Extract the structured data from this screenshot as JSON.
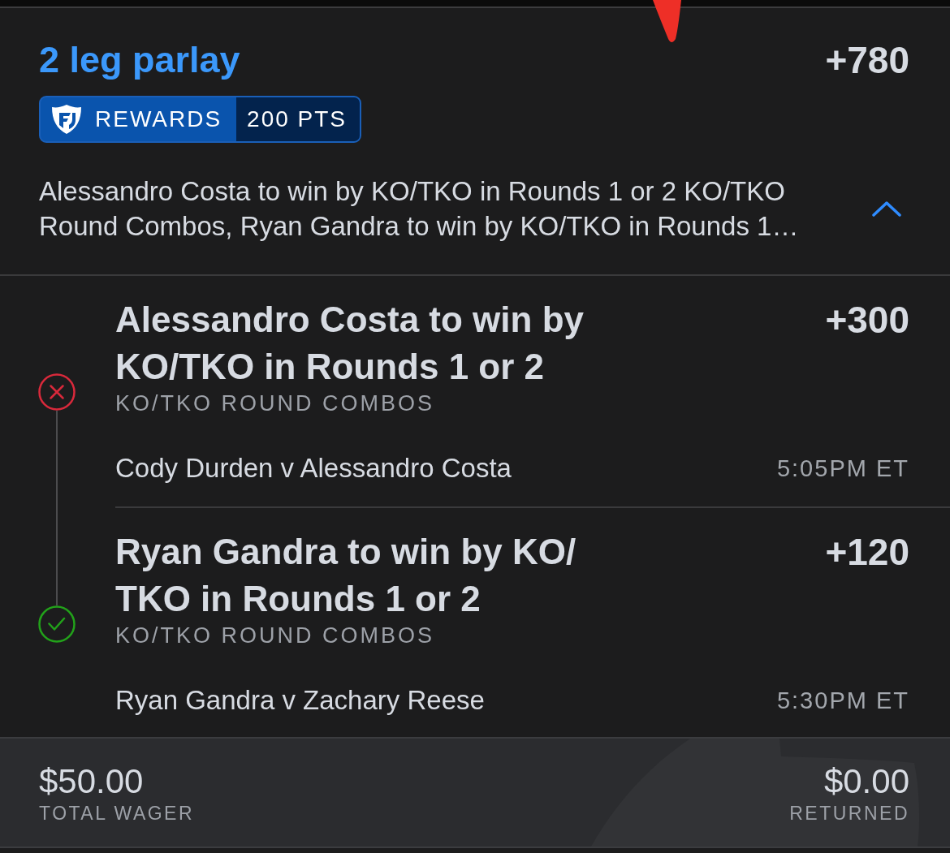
{
  "header": {
    "title": "2 leg parlay",
    "odds": "+780",
    "rewards": {
      "label": "REWARDS",
      "points": "200 PTS"
    },
    "summary": "Alessandro Costa to win by KO/TKO in Rounds 1 or 2 KO/TKO Round Combos, Ryan Gandra to win by KO/TKO in Rounds 1…",
    "expanded": true
  },
  "legs": [
    {
      "won": false,
      "selection": "Alessandro Costa to win by KO/TKO in Rounds 1 or 2",
      "odds": "+300",
      "market": "KO/TKO ROUND COMBOS",
      "event": "Cody Durden v Alessandro Costa",
      "time": "5:05PM ET"
    },
    {
      "won": true,
      "selection": "Ryan Gandra to win by KO/TKO in Rounds 1 or 2",
      "odds": "+120",
      "market": "KO/TKO ROUND COMBOS",
      "event": "Ryan Gandra v Zachary Reese",
      "time": "5:30PM ET"
    }
  ],
  "totals": [
    {
      "amount": "$50.00",
      "label": "TOTAL WAGER"
    },
    {
      "amount": "$0.00",
      "label": "RETURNED"
    }
  ]
}
